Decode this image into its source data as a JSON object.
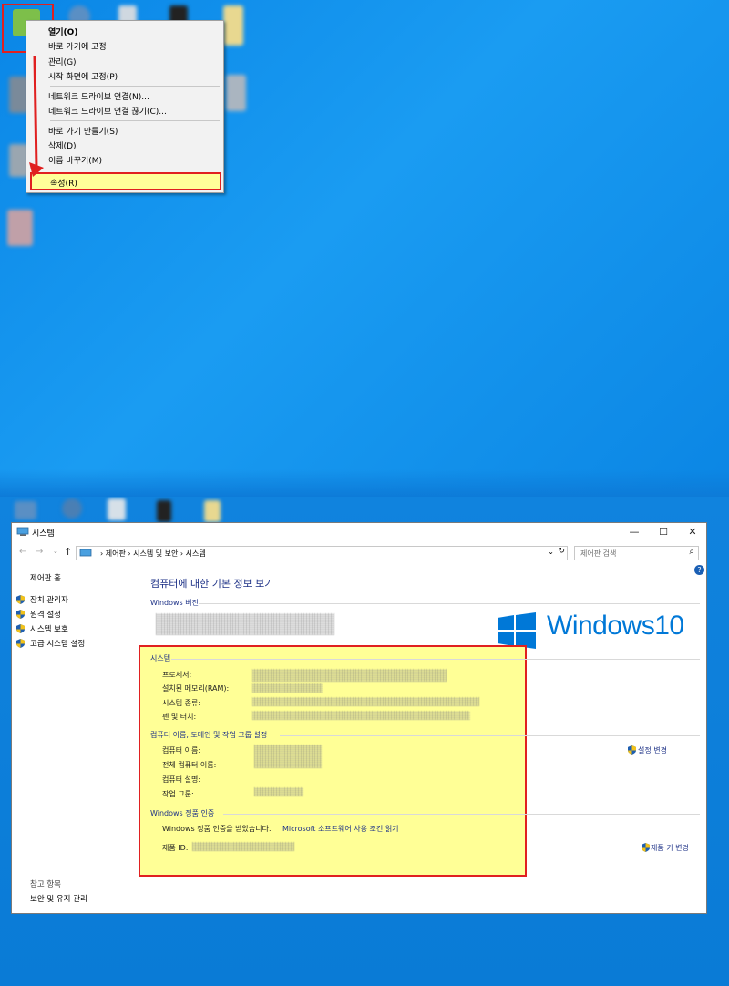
{
  "context_menu": {
    "items": [
      "열기(O)",
      "바로 가기에 고정",
      "관리(G)",
      "시작 화면에 고정(P)",
      "네트워크 드라이브 연결(N)...",
      "네트워크 드라이브 연결 끊기(C)...",
      "바로 가기 만들기(S)",
      "삭제(D)",
      "이름 바꾸기(M)"
    ],
    "highlighted_item": "속성(R)"
  },
  "window": {
    "title": "시스템",
    "controls": {
      "minimize": "—",
      "maximize": "☐",
      "close": "✕"
    },
    "breadcrumb": "›  제어판  ›  시스템 및 보안  ›  시스템",
    "search_placeholder": "제어판 검색",
    "sidebar": {
      "home": "제어판 홈",
      "links": [
        "장치 관리자",
        "원격 설정",
        "시스템 보호",
        "고급 시스템 설정"
      ],
      "see_also_title": "참고 항목",
      "see_also": "보안 및 유지 관리"
    },
    "main": {
      "heading": "컴퓨터에 대한 기본 정보 보기",
      "windows_edition_label": "Windows 버전",
      "windows_logo_text": "Windows10",
      "system_section": "시스템",
      "system_labels": [
        "프로세서:",
        "설치된 메모리(RAM):",
        "시스템 종류:",
        "펜 및 터치:"
      ],
      "computer_section": "컴퓨터 이름, 도메인 및 작업 그룹 설정",
      "computer_labels": [
        "컴퓨터 이름:",
        "전체 컴퓨터 이름:",
        "컴퓨터 설명:",
        "작업 그룹:"
      ],
      "change_settings": "설정 변경",
      "activation_section": "Windows 정품 인증",
      "activation_status": "Windows 정품 인증을 받았습니다.",
      "license_link": "Microsoft 소프트웨어 사용 조건 읽기",
      "product_id_label": "제품 ID:",
      "change_product_key": "제품 키 변경"
    }
  },
  "colors": {
    "desktop": "#0a86e6",
    "highlight_border": "#e02020",
    "highlight_fill": "#ffff99",
    "heading": "#1e3287",
    "windows_blue": "#0078d7"
  }
}
